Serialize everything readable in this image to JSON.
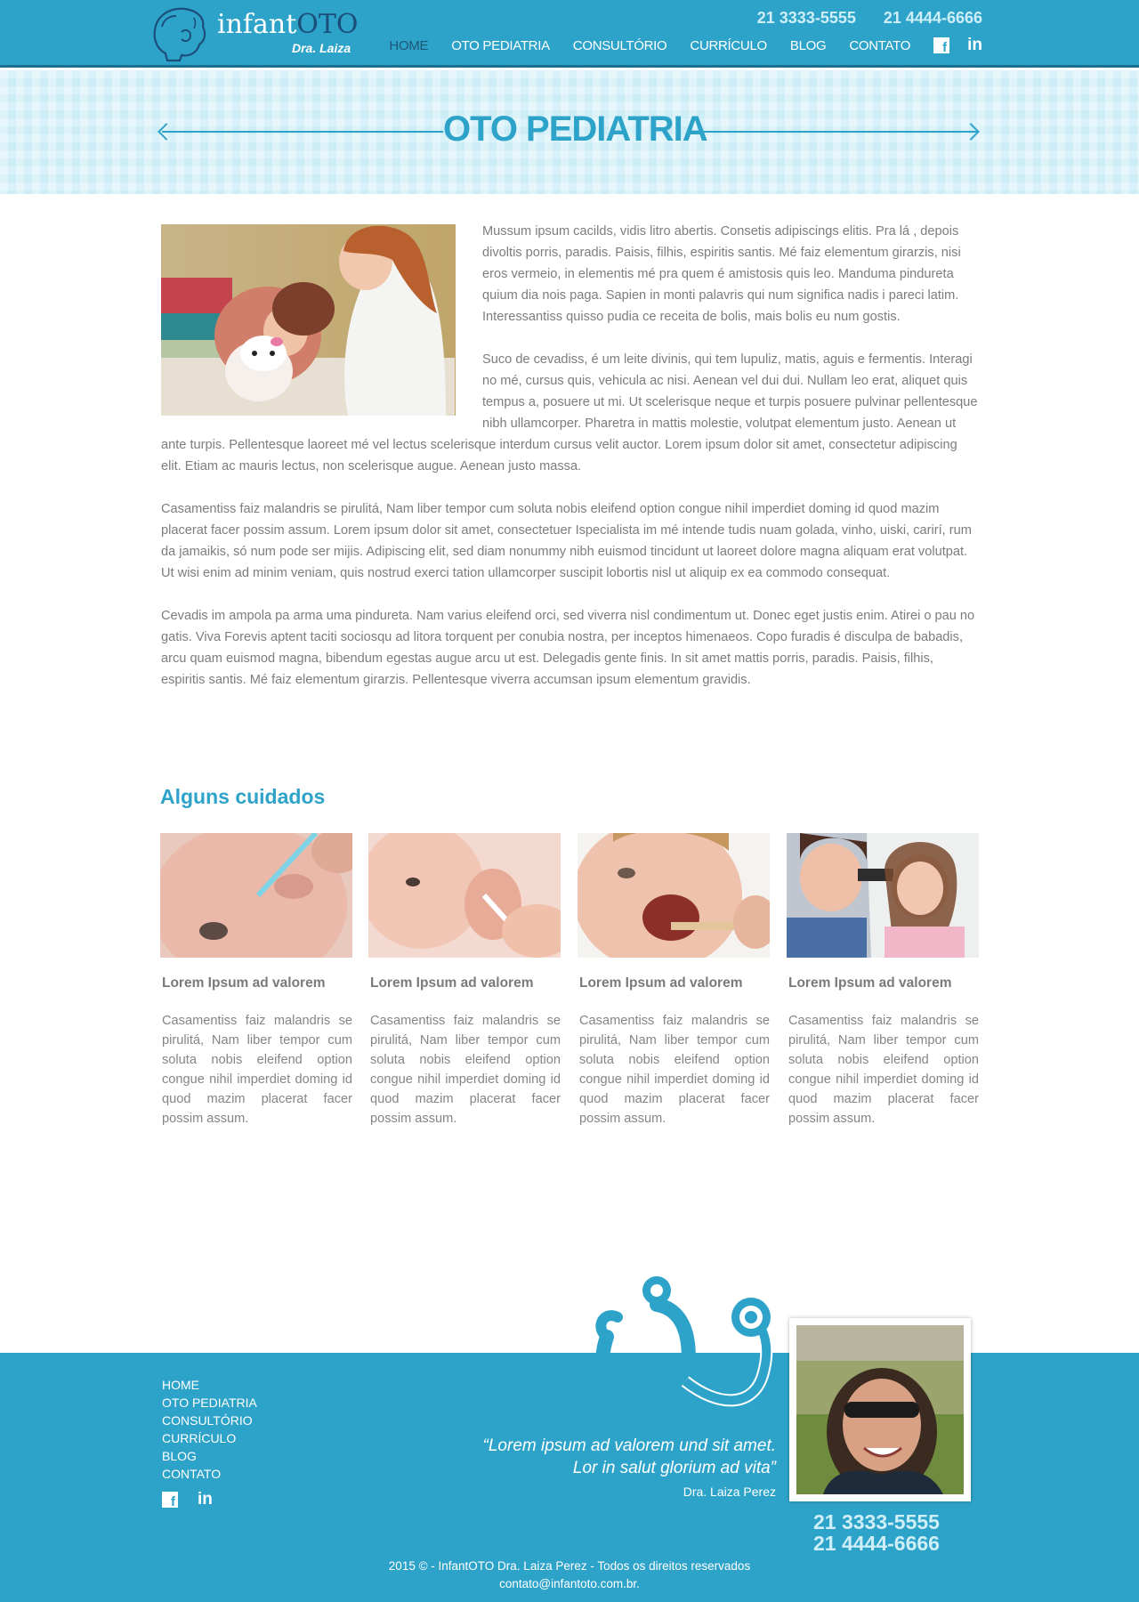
{
  "brand": {
    "name_light": "infant",
    "name_strong": "OTO",
    "subtitle": "Dra. Laiza"
  },
  "header": {
    "phones": [
      "21  3333-5555",
      "21  4444-6666"
    ],
    "nav": [
      "HOME",
      "OTO PEDIATRIA",
      "CONSULTÓRIO",
      "CURRÍCULO",
      "BLOG",
      "CONTATO"
    ],
    "active_item": "HOME",
    "social_icons": [
      "facebook-icon",
      "linkedin-icon"
    ],
    "linkedin_glyph": "in"
  },
  "hero": {
    "title": "OTO PEDIATRIA"
  },
  "main": {
    "paragraphs": [
      "Mussum ipsum cacilds, vidis litro abertis. Consetis adipiscings elitis. Pra lá , depois divoltis porris, paradis. Paisis, filhis, espiritis santis. Mé faiz elementum girarzis, nisi eros vermeio, in elementis mé pra quem é amistosis quis leo. Manduma pindureta quium dia nois paga. Sapien in monti palavris qui num significa nadis i pareci latim. Interessantiss quisso pudia ce receita de bolis, mais bolis eu num gostis.",
      "Suco de cevadiss, é um leite divinis, qui tem lupuliz, matis, aguis e fermentis. Interagi no mé, cursus quis, vehicula ac nisi. Aenean vel dui dui. Nullam leo erat, aliquet quis tempus a, posuere ut mi. Ut scelerisque neque et turpis posuere pulvinar pellentesque nibh ullamcorper. Pharetra in mattis molestie, volutpat elementum justo. Aenean ut ante turpis. Pellentesque laoreet mé vel lectus scelerisque interdum cursus velit auctor. Lorem ipsum dolor sit amet, consectetur adipiscing elit. Etiam ac mauris lectus, non scelerisque augue. Aenean justo massa.",
      "Casamentiss faiz malandris se pirulitá, Nam liber tempor cum soluta nobis eleifend option congue nihil imperdiet doming id quod mazim placerat facer possim assum. Lorem ipsum dolor sit amet, consectetuer Ispecialista im mé intende tudis nuam golada, vinho, uiski, carirí, rum da jamaikis, só num pode ser mijis. Adipiscing elit, sed diam nonummy nibh euismod tincidunt ut laoreet dolore magna aliquam erat volutpat. Ut wisi enim ad minim veniam, quis nostrud exerci tation ullamcorper suscipit lobortis nisl ut aliquip ex ea commodo consequat.",
      "Cevadis im ampola pa arma uma pindureta. Nam varius eleifend orci, sed viverra nisl condimentum ut. Donec eget justis enim. Atirei o pau no gatis. Viva Forevis aptent taciti sociosqu ad litora torquent per conubia nostra, per inceptos himenaeos. Copo furadis é disculpa de babadis, arcu quam euismod magna, bibendum egestas augue arcu ut est. Delegadis gente finis. In sit amet mattis porris, paradis. Paisis, filhis, espiritis santis. Mé faiz elementum girarzis. Pellentesque viverra accumsan ipsum elementum gravidis."
    ]
  },
  "care": {
    "title": "Alguns cuidados",
    "cards": [
      {
        "title": "Lorem Ipsum ad valorem",
        "text": "Casamentiss faiz malandris se pirulitá, Nam liber tempor cum soluta nobis eleifend option congue nihil imperdiet doming id quod mazim placerat facer possim assum."
      },
      {
        "title": "Lorem Ipsum ad valorem",
        "text": "Casamentiss faiz malandris se pirulitá, Nam liber tempor cum soluta nobis eleifend option congue nihil imperdiet doming id quod mazim placerat facer possim assum."
      },
      {
        "title": "Lorem Ipsum ad valorem",
        "text": "Casamentiss faiz malandris se pirulitá, Nam liber tempor cum soluta nobis eleifend option congue nihil imperdiet doming id quod mazim placerat facer possim assum."
      },
      {
        "title": "Lorem Ipsum ad valorem",
        "text": "Casamentiss faiz malandris se pirulitá, Nam liber tempor cum soluta nobis eleifend option congue nihil imperdiet doming id quod mazim placerat facer possim assum."
      }
    ]
  },
  "footer": {
    "nav": [
      "HOME",
      "OTO PEDIATRIA",
      "CONSULTÓRIO",
      "CURRÍCULO",
      "BLOG",
      "CONTATO"
    ],
    "quote_line1": "“Lorem ipsum ad valorem und sit amet.",
    "quote_line2": "Lor in salut glorium ad vita”",
    "quote_author": "Dra. Laiza Perez",
    "phones": [
      "21  3333-5555",
      "21  4444-6666"
    ],
    "copyright": "2015 © - InfantOTO Dra. Laiza Perez - Todos os direitos reservados",
    "email": "contato@infantoto.com.br."
  },
  "colors": {
    "primary": "#2ea3c9",
    "dark_blue": "#1d5679",
    "text_gray": "#7d7d7d",
    "phone_light": "#cfeff8"
  }
}
